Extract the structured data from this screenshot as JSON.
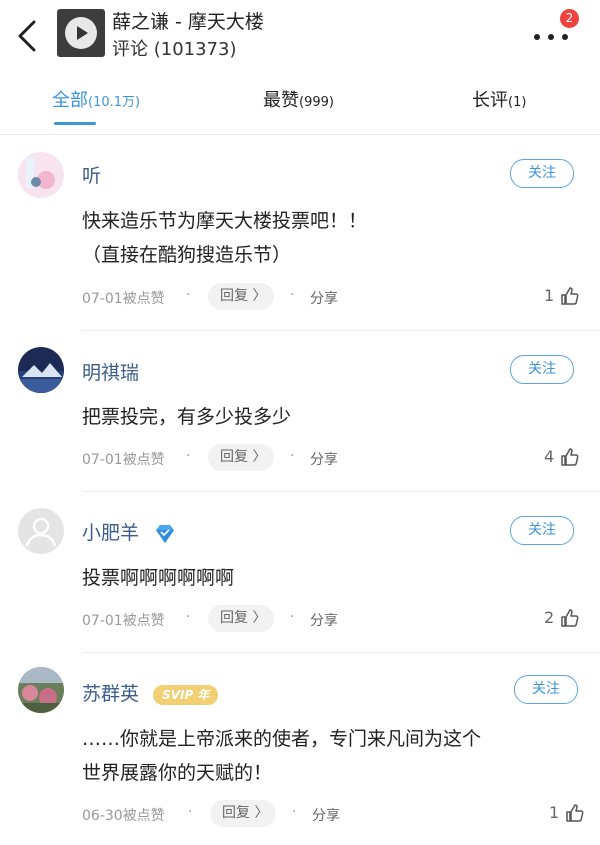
{
  "header": {
    "title": "薛之谦 - 摩天大楼",
    "subtitle": "评论 (101373)",
    "notification_count": "2",
    "back_icon": "back-chevron-icon",
    "more_icon": "more-dots-icon"
  },
  "tabs": [
    {
      "label": "全部",
      "count": "(10.1万)",
      "active": true
    },
    {
      "label": "最赞",
      "count": "(999)",
      "active": false
    },
    {
      "label": "长评",
      "count": "(1)",
      "active": false
    }
  ],
  "comments": [
    {
      "username": "听",
      "follow_label": "关注",
      "content_lines": [
        "快来造乐节为摩天大楼投票吧！！",
        "（直接在酷狗搜造乐节）"
      ],
      "date": "07-01",
      "liked_text": "被点赞",
      "reply_label": "回复 〉",
      "share_label": "分享",
      "likes": "1"
    },
    {
      "username": "明祺瑞",
      "follow_label": "关注",
      "content_lines": [
        "把票投完，有多少投多少"
      ],
      "date": "07-01",
      "liked_text": "被点赞",
      "reply_label": "回复 〉",
      "share_label": "分享",
      "likes": "4"
    },
    {
      "username": "小肥羊",
      "follow_label": "关注",
      "content_lines": [
        "投票啊啊啊啊啊啊"
      ],
      "date": "07-01",
      "liked_text": "被点赞",
      "reply_label": "回复 〉",
      "share_label": "分享",
      "likes": "2",
      "badge_icon": "diamond-icon"
    },
    {
      "username": "苏群英",
      "follow_label": "关注",
      "content_lines": [
        "……你就是上帝派来的使者，专门来凡间为这个",
        "世界展露你的天赋的！"
      ],
      "date": "06-30",
      "liked_text": "被点赞",
      "reply_label": "回复 〉",
      "share_label": "分享",
      "likes": "1",
      "svip_label": "SVIP 年"
    }
  ],
  "colors": {
    "accent": "#3b95dc",
    "username": "#3c5e8c",
    "badge": "#f0423f",
    "svip": "#f3cf74"
  }
}
